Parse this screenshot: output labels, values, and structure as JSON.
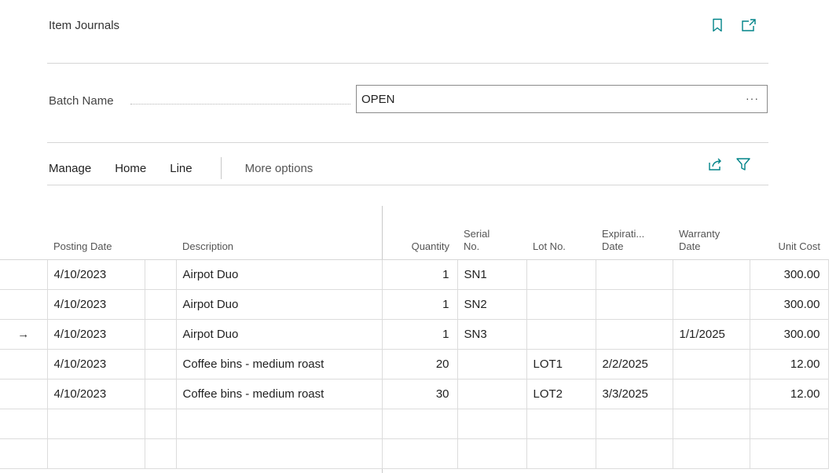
{
  "page": {
    "title": "Item Journals"
  },
  "header_icons": [
    "bookmark-icon",
    "open-new-window-icon"
  ],
  "batch": {
    "label": "Batch Name",
    "value": "OPEN",
    "ellipsis": "···"
  },
  "actions": {
    "manage": "Manage",
    "home": "Home",
    "line": "Line",
    "more": "More options"
  },
  "action_icons": [
    "share-icon",
    "filter-icon"
  ],
  "columns": {
    "posting_date": "Posting Date",
    "description": "Description",
    "quantity": "Quantity",
    "serial_no_1": "Serial",
    "serial_no_2": "No.",
    "lot_no": "Lot No.",
    "expiration_1": "Expirati...",
    "expiration_2": "Date",
    "warranty_1": "Warranty",
    "warranty_2": "Date",
    "unit_cost": "Unit Cost"
  },
  "rows": [
    {
      "indicator": "",
      "posting_date": "4/10/2023",
      "description": "Airpot Duo",
      "quantity": "1",
      "serial_no": "SN1",
      "lot_no": "",
      "expiration_date": "",
      "warranty_date": "",
      "unit_cost": "300.00"
    },
    {
      "indicator": "",
      "posting_date": "4/10/2023",
      "description": "Airpot Duo",
      "quantity": "1",
      "serial_no": "SN2",
      "lot_no": "",
      "expiration_date": "",
      "warranty_date": "",
      "unit_cost": "300.00"
    },
    {
      "indicator": "→",
      "posting_date": "4/10/2023",
      "description": "Airpot Duo",
      "quantity": "1",
      "serial_no": "SN3",
      "lot_no": "",
      "expiration_date": "",
      "warranty_date": "1/1/2025",
      "unit_cost": "300.00"
    },
    {
      "indicator": "",
      "posting_date": "4/10/2023",
      "description": "Coffee bins - medium roast",
      "quantity": "20",
      "serial_no": "",
      "lot_no": "LOT1",
      "expiration_date": "2/2/2025",
      "warranty_date": "",
      "unit_cost": "12.00"
    },
    {
      "indicator": "",
      "posting_date": "4/10/2023",
      "description": "Coffee bins - medium roast",
      "quantity": "30",
      "serial_no": "",
      "lot_no": "LOT2",
      "expiration_date": "3/3/2025",
      "warranty_date": "",
      "unit_cost": "12.00"
    }
  ],
  "colors": {
    "accent": "#008489",
    "border": "#d6d6d6"
  }
}
